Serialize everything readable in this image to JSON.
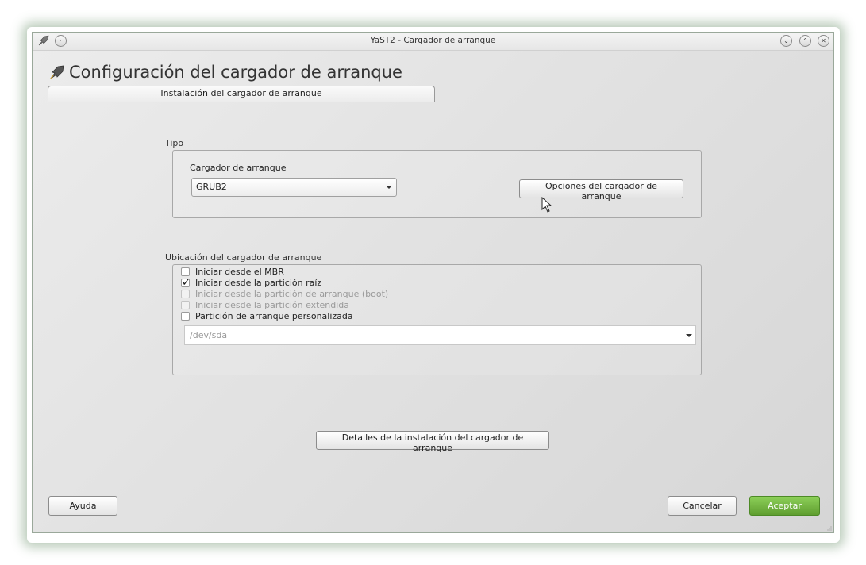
{
  "window": {
    "title": "YaST2 - Cargador de arranque",
    "controls": [
      "minimize-icon",
      "maximize-icon",
      "close-icon"
    ]
  },
  "page": {
    "title": "Configuración del cargador de arranque",
    "icon": "rocket-icon"
  },
  "tabs": [
    {
      "label": "Instalación del cargador de arranque",
      "selected": true
    }
  ],
  "tipo": {
    "group_label": "Tipo",
    "loader_label": "Cargador de arranque",
    "loader_value": "GRUB2",
    "options_button": "Opciones del cargador de arranque"
  },
  "location": {
    "group_label": "Ubicación del cargador de arranque",
    "options": [
      {
        "label": "Iniciar desde el MBR",
        "checked": false,
        "enabled": true
      },
      {
        "label": "Iniciar desde la partición raíz",
        "checked": true,
        "enabled": true
      },
      {
        "label": "Iniciar desde la partición de arranque (boot)",
        "checked": false,
        "enabled": false
      },
      {
        "label": "Iniciar desde la partición extendida",
        "checked": false,
        "enabled": false
      },
      {
        "label": "Partición de arranque personalizada",
        "checked": false,
        "enabled": true
      }
    ],
    "custom_partition": "/dev/sda"
  },
  "details_button": "Detalles de la instalación del cargador de arranque",
  "footer": {
    "help": "Ayuda",
    "cancel": "Cancelar",
    "accept": "Aceptar"
  },
  "colors": {
    "accept": "#6aab3a",
    "window_border": "#9aa89a"
  }
}
